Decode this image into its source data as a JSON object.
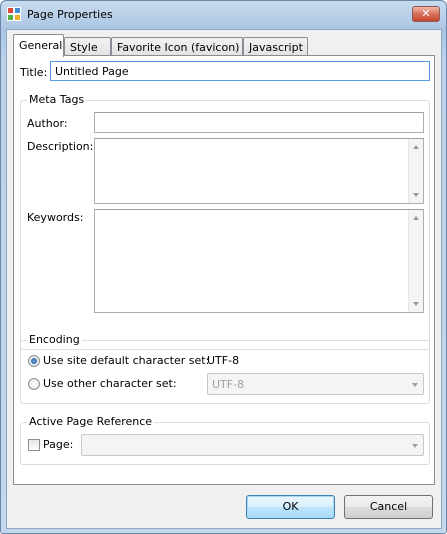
{
  "window": {
    "title": "Page Properties",
    "close_glyph": "✕"
  },
  "tabs": [
    {
      "label": "General",
      "active": true
    },
    {
      "label": "Style",
      "active": false
    },
    {
      "label": "Favorite Icon (favicon)",
      "active": false
    },
    {
      "label": "Javascript",
      "active": false
    }
  ],
  "general": {
    "title_label": "Title:",
    "title_value": "Untitled Page",
    "meta_tags": {
      "group_title": "Meta Tags",
      "author_label": "Author:",
      "author_value": "",
      "description_label": "Description:",
      "description_value": "",
      "keywords_label": "Keywords:",
      "keywords_value": ""
    },
    "encoding": {
      "group_title": "Encoding",
      "default_option_label": "Use site default character set:",
      "default_charset": "UTF-8",
      "other_option_label": "Use other character set:",
      "other_charset_value": "UTF-8",
      "selected": "default"
    },
    "active_page_reference": {
      "group_title": "Active Page Reference",
      "page_label": "Page:",
      "page_checked": false,
      "page_value": ""
    }
  },
  "buttons": {
    "ok_label": "OK",
    "cancel_label": "Cancel"
  },
  "colors": {
    "app_icon": [
      "#e0463a",
      "#3f8fd6",
      "#55b043",
      "#f2b232"
    ]
  }
}
